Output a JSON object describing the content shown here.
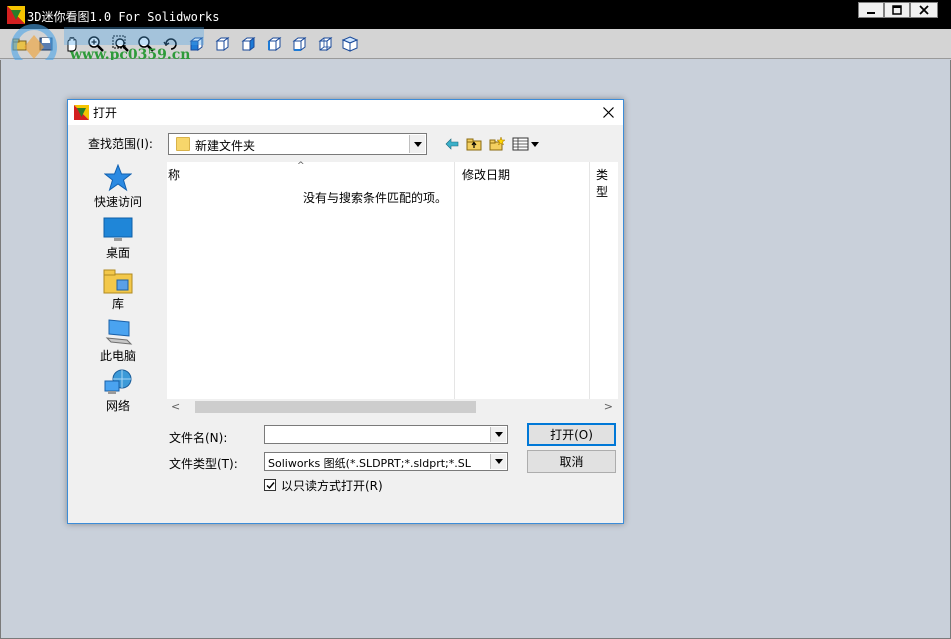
{
  "window": {
    "title": "3D迷你看图1.0 For Solidworks",
    "watermark_text": "www.pc0359.cn",
    "controls": {
      "minimize": "minimize",
      "maximize": "maximize",
      "close": "close"
    }
  },
  "toolbar": {
    "buttons": [
      "open-icon",
      "save-icon",
      "pan-icon",
      "zoom-in-icon",
      "zoom-window-icon",
      "zoom-icon",
      "rotate-icon",
      "view-front-icon",
      "view-back-icon",
      "view-left-icon",
      "view-right-icon",
      "view-top-icon",
      "view-bottom-icon",
      "view-iso-icon"
    ]
  },
  "dialog": {
    "title": "打开",
    "lookin_label": "查找范围(I):",
    "lookin_value": "新建文件夹",
    "places": [
      {
        "label": "快速访问",
        "icon": "star-icon"
      },
      {
        "label": "桌面",
        "icon": "desktop-icon"
      },
      {
        "label": "库",
        "icon": "library-icon"
      },
      {
        "label": "此电脑",
        "icon": "computer-icon"
      },
      {
        "label": "网络",
        "icon": "network-icon"
      }
    ],
    "columns": {
      "name": "称",
      "modified": "修改日期",
      "type": "类型"
    },
    "empty_message": "没有与搜索条件匹配的项。",
    "filename_label": "文件名(N):",
    "filename_value": "",
    "filetype_label": "文件类型(T):",
    "filetype_value": "Soliworks 图纸(*.SLDPRT;*.sldprt;*.SL",
    "readonly_label": "以只读方式打开(R)",
    "readonly_checked": true,
    "open_button": "打开(O)",
    "cancel_button": "取消"
  },
  "colors": {
    "titlebar": "#000000",
    "workspace": "#c9d0da",
    "dialog_border": "#3c8cd8",
    "accent": "#0078d7"
  }
}
